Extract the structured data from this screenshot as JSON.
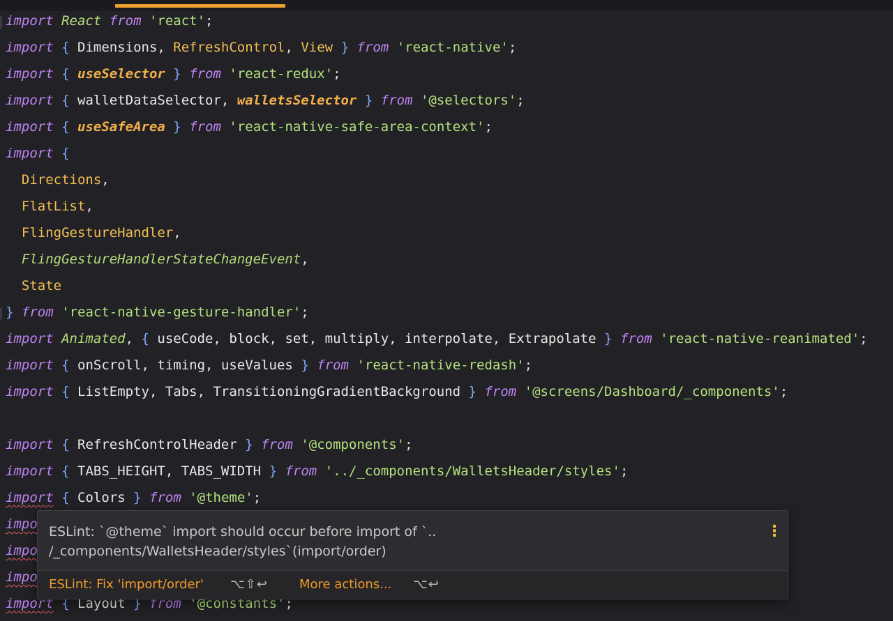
{
  "editor": {
    "tab_accent_color": "#f0a030"
  },
  "code": {
    "l1": {
      "t1": "import",
      "t2": "React",
      "t3": "from",
      "t4": "'react'",
      "t5": ";"
    },
    "l2": {
      "t1": "import",
      "t2": "{",
      "t3": "Dimensions,",
      "t4": "RefreshControl",
      "t5": ",",
      "t6": "View",
      "t7": "}",
      "t8": "from",
      "t9": "'react-native'",
      "t10": ";"
    },
    "l3": {
      "t1": "import",
      "t2": "{",
      "t3": "useSelector",
      "t4": "}",
      "t5": "from",
      "t6": "'react-redux'",
      "t7": ";"
    },
    "l4": {
      "t1": "import",
      "t2": "{",
      "t3": "walletDataSelector,",
      "t4": "walletsSelector",
      "t5": "}",
      "t6": "from",
      "t7": "'@selectors'",
      "t8": ";"
    },
    "l5": {
      "t1": "import",
      "t2": "{",
      "t3": "useSafeArea",
      "t4": "}",
      "t5": "from",
      "t6": "'react-native-safe-area-context'",
      "t7": ";"
    },
    "l6": {
      "t1": "import",
      "t2": "{"
    },
    "l7": {
      "t1": "Directions",
      "t2": ","
    },
    "l8": {
      "t1": "FlatList",
      "t2": ","
    },
    "l9": {
      "t1": "FlingGestureHandler",
      "t2": ","
    },
    "l10": {
      "t1": "FlingGestureHandlerStateChangeEvent",
      "t2": ","
    },
    "l11": {
      "t1": "State"
    },
    "l12": {
      "t1": "}",
      "t2": "from",
      "t3": "'react-native-gesture-handler'",
      "t4": ";"
    },
    "l13": {
      "t1": "import",
      "t2": "Animated",
      "t3": ",",
      "t4": "{",
      "t5": "useCode, block, set, multiply, interpolate, Extrapolate",
      "t6": "}",
      "t7": "from",
      "t8": "'react-native-reanimated'",
      "t9": ";"
    },
    "l14": {
      "t1": "import",
      "t2": "{",
      "t3": "onScroll, timing, useValues",
      "t4": "}",
      "t5": "from",
      "t6": "'react-native-redash'",
      "t7": ";"
    },
    "l15": {
      "t1": "import",
      "t2": "{",
      "t3": "ListEmpty, Tabs, TransitioningGradientBackground",
      "t4": "}",
      "t5": "from",
      "t6": "'@screens/Dashboard/_components'",
      "t7": ";"
    },
    "l17": {
      "t1": "import",
      "t2": "{",
      "t3": "RefreshControlHeader",
      "t4": "}",
      "t5": "from",
      "t6": "'@components'",
      "t7": ";"
    },
    "l18": {
      "t1": "import",
      "t2": "{",
      "t3": "TABS_HEIGHT, TABS_WIDTH",
      "t4": "}",
      "t5": "from",
      "t6": "'../_components/WalletsHeader/styles'",
      "t7": ";"
    },
    "l19": {
      "t1": "import",
      "t2": "{",
      "t3": "Colors",
      "t4": "}",
      "t5": "from",
      "t6": "'@theme'",
      "t7": ";"
    },
    "l20": {
      "t1": "impo"
    },
    "l21": {
      "t1": "impo"
    },
    "l22": {
      "t1": "impo"
    },
    "l23": {
      "t1": "import",
      "t2": "{",
      "t3": "Layout",
      "t4": "}",
      "t5": "from",
      "t6": "'@constants'",
      "t7": ";"
    }
  },
  "popup": {
    "message_line1": "ESLint: `@theme` import should occur before import of `..",
    "message_line2": "/_components/WalletsHeader/styles`(import/order)",
    "fix_action": "ESLint: Fix 'import/order'",
    "fix_shortcut": "⌥⇧↩",
    "more_action": "More actions...",
    "more_shortcut": "⌥↩"
  }
}
